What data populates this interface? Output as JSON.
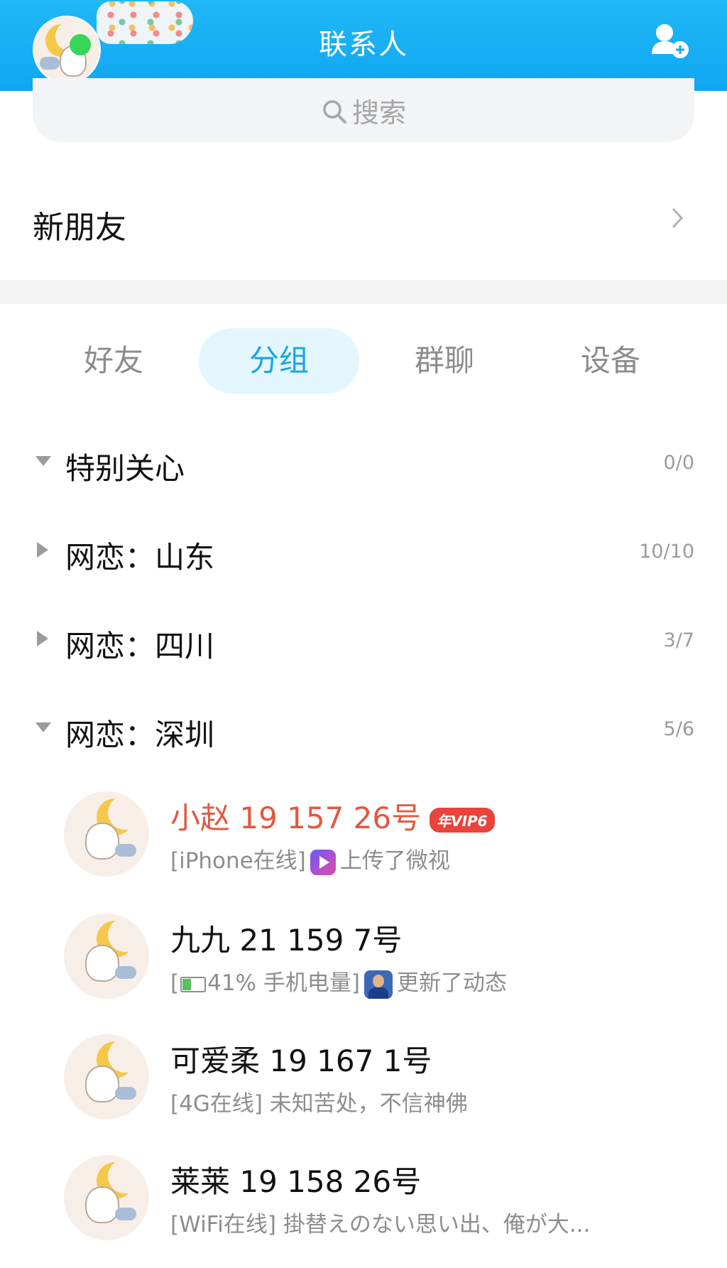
{
  "header": {
    "title": "联系人",
    "icons": {
      "add_friend": "add-friend-icon",
      "avatar": "user-avatar"
    },
    "colors": {
      "bar": "#10a6f2",
      "online_dot": "#37d65a"
    }
  },
  "search": {
    "placeholder": "搜索",
    "icon": "search-icon"
  },
  "new_friends": {
    "label": "新朋友",
    "icon": "chevron-right-icon"
  },
  "tabs": [
    {
      "label": "好友",
      "active": false
    },
    {
      "label": "分组",
      "active": true
    },
    {
      "label": "群聊",
      "active": false
    },
    {
      "label": "设备",
      "active": false
    }
  ],
  "groups": [
    {
      "name": "特别关心",
      "count": "0/0",
      "expanded": true
    },
    {
      "name": "网恋：山东",
      "count": "10/10",
      "expanded": false
    },
    {
      "name": "网恋：四川",
      "count": "3/7",
      "expanded": false
    },
    {
      "name": "网恋：深圳",
      "count": "5/6",
      "expanded": true
    }
  ],
  "contacts": [
    {
      "name": "小赵 19 157 26号",
      "vip_badge": "年VIP6",
      "status_prefix": "[iPhone在线]",
      "status_text": "上传了微视",
      "status_icon": "weishi-icon",
      "name_color": "#e2583f"
    },
    {
      "name": "九九 21 159 7号",
      "status_prefix": "[",
      "battery_percent": "41%",
      "battery_level": 0.41,
      "status_mid": " 手机电量]",
      "status_text": "更新了动态",
      "status_icon": "friend-avatar-thumbnail"
    },
    {
      "name": "可爱柔 19 167 1号",
      "status_prefix": "[4G在线]",
      "status_text": "未知苦处，不信神佛"
    },
    {
      "name": "莱莱 19 158 26号",
      "status_prefix": "[WiFi在线]",
      "status_text": "掛替えのない思い出、俺が大..."
    }
  ]
}
